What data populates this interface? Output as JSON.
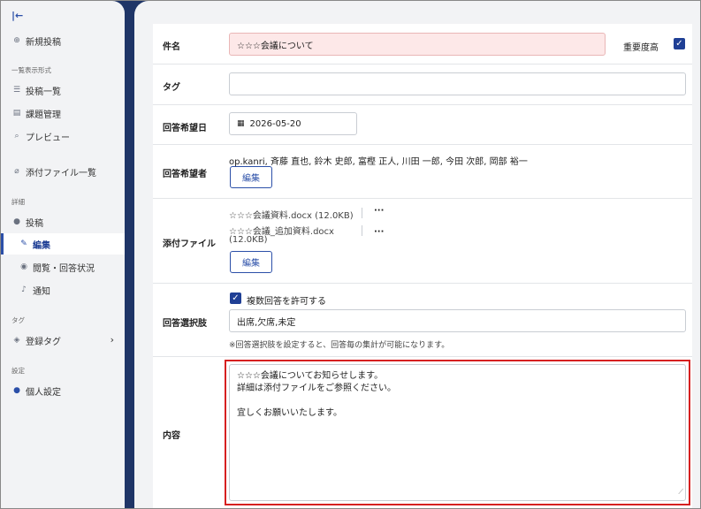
{
  "sidebar": {
    "collapse_icon": "collapse-left-icon",
    "new_post": "新規投稿",
    "section_list": "一覧表示形式",
    "post_list": "投稿一覧",
    "task_mgmt": "課題管理",
    "preview": "プレビュー",
    "attachments": "添付ファイル一覧",
    "section_detail": "詳細",
    "post": "投稿",
    "edit": "編集",
    "view_status": "閲覧・回答状況",
    "notify": "通知",
    "section_tag": "タグ",
    "registered_tags": "登録タグ",
    "section_settings": "設定",
    "personal_settings": "個人設定"
  },
  "form": {
    "subject_label": "件名",
    "subject_value": "☆☆☆会議について",
    "importance_label": "重要度高",
    "tag_label": "タグ",
    "tag_value": "",
    "desired_date_label": "回答希望日",
    "desired_date_value": "2026-05-20",
    "respondents_label": "回答希望者",
    "respondents_value": "op.kanri, 斉藤 直也, 鈴木 史郎, 富樫 正人, 川田 一郎, 今田 次郎, 岡部 裕一",
    "edit_button": "編集",
    "attachments_label": "添付ファイル",
    "file1": "☆☆☆会議資料.docx (12.0KB)",
    "file2_line1": "☆☆☆会議_追加資料.docx",
    "file2_line2": "(12.0KB)",
    "more": "···",
    "choices_label": "回答選択肢",
    "allow_multiple": "複数回答を許可する",
    "choices_value": "出席,欠席,未定",
    "choices_hint": "※回答選択肢を設定すると、回答毎の集計が可能になります。",
    "content_label": "内容",
    "content_line1": "☆☆☆会議についてお知らせします。",
    "content_line2": "詳細は添付ファイルをご参照ください。",
    "content_line3": "",
    "content_line4": "宜しくお願いいたします。"
  },
  "colors": {
    "sidebar_bg": "#f2f3f5",
    "frame_dark": "#1f3567",
    "accent": "#2b4fa8",
    "highlight_border": "#d62020",
    "subject_bg": "#fde8e8"
  }
}
